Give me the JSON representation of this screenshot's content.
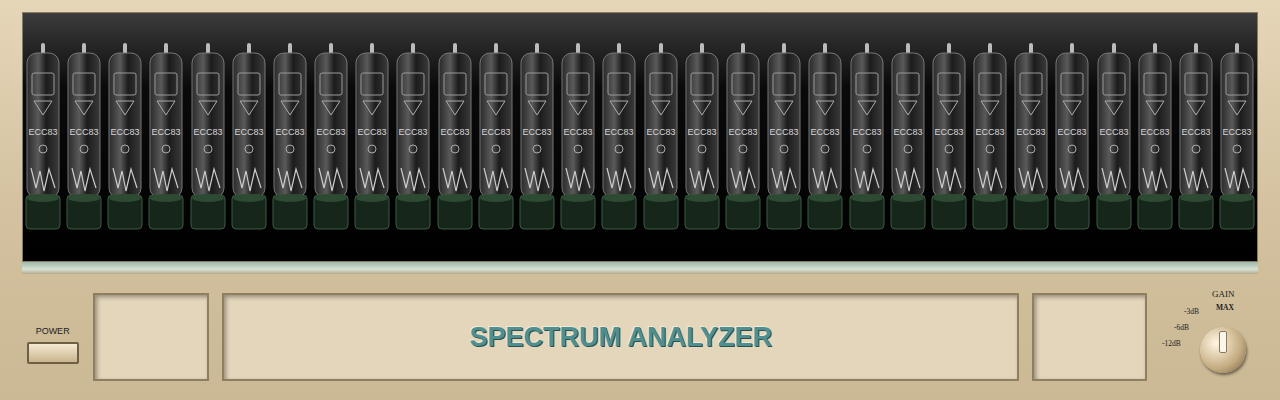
{
  "display": {
    "tubes": [
      {
        "label": "ECC83"
      },
      {
        "label": "ECC83"
      },
      {
        "label": "ECC83"
      },
      {
        "label": "ECC83"
      },
      {
        "label": "ECC83"
      },
      {
        "label": "ECC83"
      },
      {
        "label": "ECC83"
      },
      {
        "label": "ECC83"
      },
      {
        "label": "ECC83"
      },
      {
        "label": "ECC83"
      },
      {
        "label": "ECC83"
      },
      {
        "label": "ECC83"
      },
      {
        "label": "ECC83"
      },
      {
        "label": "ECC83"
      },
      {
        "label": "ECC83"
      },
      {
        "label": "ECC83"
      },
      {
        "label": "ECC83"
      },
      {
        "label": "ECC83"
      },
      {
        "label": "ECC83"
      },
      {
        "label": "ECC83"
      },
      {
        "label": "ECC83"
      },
      {
        "label": "ECC83"
      },
      {
        "label": "ECC83"
      },
      {
        "label": "ECC83"
      },
      {
        "label": "ECC83"
      },
      {
        "label": "ECC83"
      },
      {
        "label": "ECC83"
      },
      {
        "label": "ECC83"
      },
      {
        "label": "ECC83"
      },
      {
        "label": "ECC83"
      }
    ]
  },
  "power": {
    "label": "POWER",
    "on": false
  },
  "title": "SPECTRUM ANALYZER",
  "gain": {
    "label": "GAIN",
    "options": [
      {
        "label": "MAX",
        "selected": true
      },
      {
        "label": "-3dB",
        "selected": false
      },
      {
        "label": "-6dB",
        "selected": false
      },
      {
        "label": "-12dB",
        "selected": false
      }
    ]
  }
}
